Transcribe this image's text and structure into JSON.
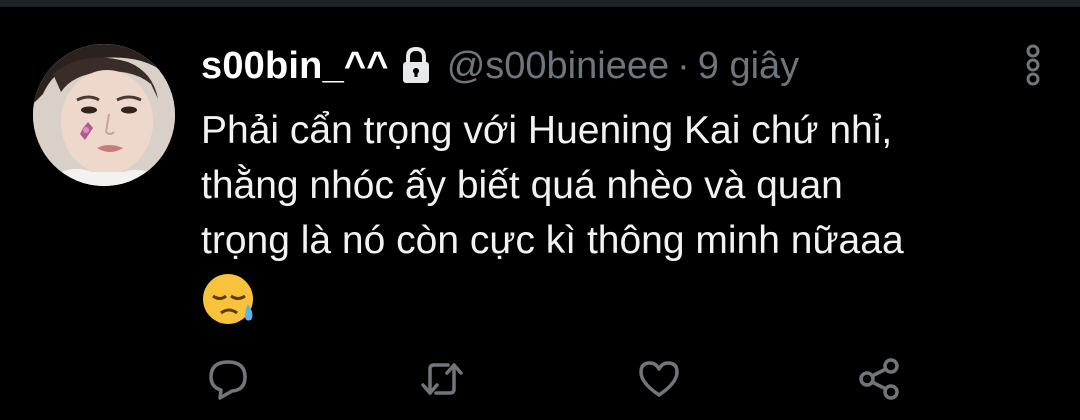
{
  "tweet": {
    "author": {
      "display_name": "s00bin_^^",
      "handle": "@s00binieee",
      "protected": true,
      "avatar_icon": "profile-photo"
    },
    "separator": "·",
    "timestamp": "9 giây",
    "text_lines": [
      "Phải cẩn trọng với Huening Kai chứ nhỉ,",
      "thằng nhóc ấy biết quá nhèo và quan",
      "trọng là nó còn cực kì thông minh nữaaa"
    ],
    "emoji": "sad-but-relieved-face",
    "menu_icon": "vertical-dots-icon"
  },
  "actions": [
    {
      "name": "reply",
      "icon": "reply-icon"
    },
    {
      "name": "retweet",
      "icon": "retweet-icon"
    },
    {
      "name": "like",
      "icon": "heart-icon"
    },
    {
      "name": "share",
      "icon": "share-icon"
    }
  ],
  "colors": {
    "background": "#000000",
    "primary_text": "#f2f2f2",
    "secondary_text": "#6e767d",
    "icon_gray": "#71767b"
  }
}
